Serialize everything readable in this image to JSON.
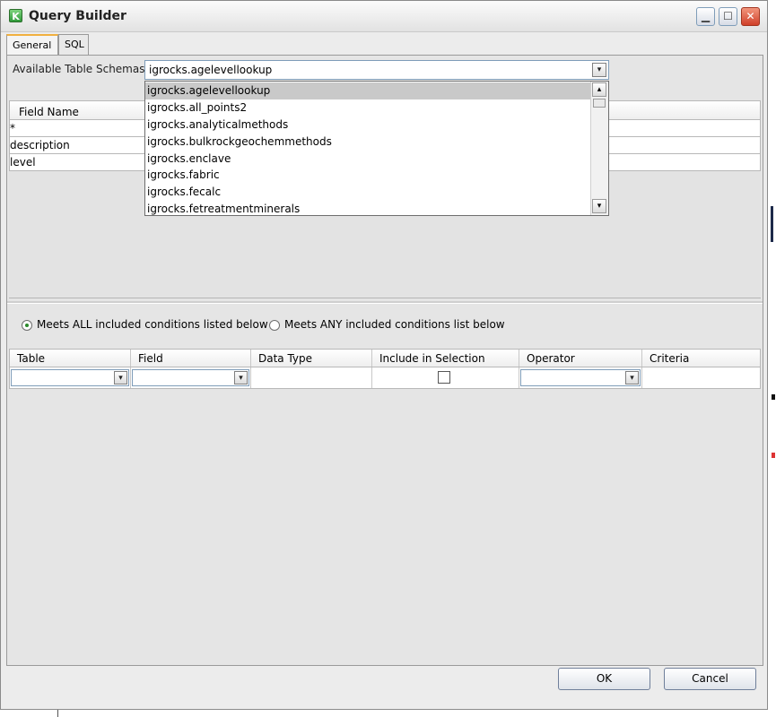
{
  "window": {
    "title": "Query Builder",
    "app_icon_letter": "K",
    "controls": {
      "minimize": "▁",
      "maximize": "☐",
      "close": "✕"
    }
  },
  "tabs": [
    {
      "label": "General",
      "active": true
    },
    {
      "label": "SQL",
      "active": false
    }
  ],
  "schema": {
    "label": "Available Table Schemas:",
    "selected": "igrocks.agelevellookup",
    "options": [
      "igrocks.agelevellookup",
      "igrocks.all_points2",
      "igrocks.analyticalmethods",
      "igrocks.bulkrockgeochemmethods",
      "igrocks.enclave",
      "igrocks.fabric",
      "igrocks.fecalc",
      "igrocks.fetreatmentminerals"
    ]
  },
  "fields_grid": {
    "header": "Field Name",
    "rows": [
      "*",
      "description",
      "level"
    ]
  },
  "conditions": {
    "match_all_label": "Meets ALL included conditions listed below",
    "match_any_label": "Meets ANY included conditions list below",
    "selected": "all",
    "columns": [
      "Table",
      "Field",
      "Data Type",
      "Include in Selection",
      "Operator",
      "Criteria"
    ]
  },
  "buttons": {
    "ok": "OK",
    "cancel": "Cancel"
  },
  "icons": {
    "dropdown": "▾",
    "scroll_up": "▴",
    "scroll_down": "▾"
  }
}
